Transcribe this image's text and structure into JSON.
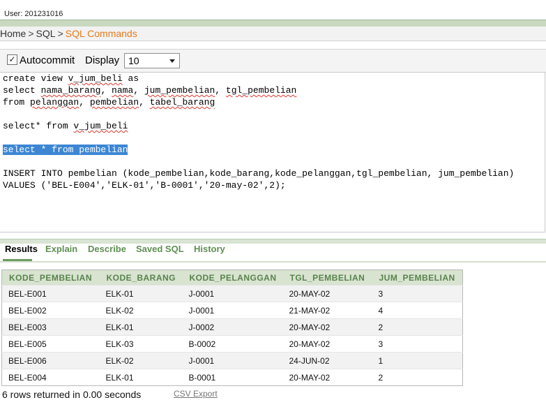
{
  "user": {
    "label": "User: 201231016"
  },
  "breadcrumb": {
    "home": "Home",
    "sql": "SQL",
    "current": "SQL Commands",
    "separator": ">"
  },
  "toolbar": {
    "autocommit_label": "Autocommit",
    "autocommit_checked": true,
    "checkmark": "✓",
    "display_label": "Display",
    "display_value": "10"
  },
  "editor": {
    "lines": [
      {
        "segments": [
          {
            "t": "create view "
          },
          {
            "t": "v_jum_beli",
            "sq": true
          },
          {
            "t": " as"
          }
        ]
      },
      {
        "segments": [
          {
            "t": "select "
          },
          {
            "t": "nama_barang",
            "sq": true
          },
          {
            "t": ", "
          },
          {
            "t": "nama",
            "sq": true
          },
          {
            "t": ", "
          },
          {
            "t": "jum_pembelian",
            "sq": true
          },
          {
            "t": ", "
          },
          {
            "t": "tgl_pembelian",
            "sq": true
          }
        ]
      },
      {
        "segments": [
          {
            "t": "from "
          },
          {
            "t": "pelanggan",
            "sq": true
          },
          {
            "t": ", "
          },
          {
            "t": "pembelian",
            "sq": true
          },
          {
            "t": ", "
          },
          {
            "t": "tabel_barang",
            "sq": true
          }
        ]
      },
      {
        "segments": []
      },
      {
        "segments": [
          {
            "t": "select* from "
          },
          {
            "t": "v_jum_beli",
            "sq": true
          }
        ]
      },
      {
        "segments": []
      },
      {
        "segments": [
          {
            "t": "select * from pembelian",
            "sel": true
          }
        ]
      },
      {
        "segments": []
      },
      {
        "segments": [
          {
            "t": "INSERT INTO pembelian (kode_pembelian,kode_barang,kode_pelanggan,tgl_pembelian, jum_pembelian)"
          }
        ]
      },
      {
        "segments": [
          {
            "t": "VALUES ('BEL-E004','ELK-01','B-0001','20-may-02',2);"
          }
        ]
      }
    ]
  },
  "tabs": [
    {
      "label": "Results",
      "active": true
    },
    {
      "label": "Explain",
      "active": false
    },
    {
      "label": "Describe",
      "active": false
    },
    {
      "label": "Saved SQL",
      "active": false
    },
    {
      "label": "History",
      "active": false
    }
  ],
  "results": {
    "columns": [
      "KODE_PEMBELIAN",
      "KODE_BARANG",
      "KODE_PELANGGAN",
      "TGL_PEMBELIAN",
      "JUM_PEMBELIAN"
    ],
    "rows": [
      [
        "BEL-E001",
        "ELK-01",
        "J-0001",
        "20-MAY-02",
        "3"
      ],
      [
        "BEL-E002",
        "ELK-02",
        "J-0001",
        "21-MAY-02",
        "4"
      ],
      [
        "BEL-E003",
        "ELK-01",
        "J-0002",
        "20-MAY-02",
        "2"
      ],
      [
        "BEL-E005",
        "ELK-03",
        "B-0002",
        "20-MAY-02",
        "3"
      ],
      [
        "BEL-E006",
        "ELK-02",
        "J-0001",
        "24-JUN-02",
        "1"
      ],
      [
        "BEL-E004",
        "ELK-01",
        "B-0001",
        "20-MAY-02",
        "2"
      ]
    ],
    "rows_returned": "6 rows returned in 0.00 seconds",
    "csv_export": "CSV Export"
  },
  "colors": {
    "accent_orange": "#e8791a",
    "tab_green": "#5f8f52",
    "header_bg": "#d8e3d0",
    "selection": "#3c86d4"
  }
}
